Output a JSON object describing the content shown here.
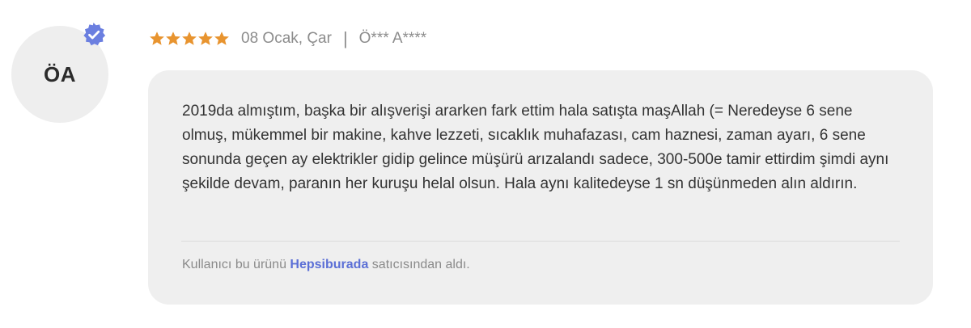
{
  "review": {
    "avatar_initials": "ÖA",
    "verified_icon": "verified-badge-icon",
    "rating": 5,
    "rating_max": 5,
    "star_color": "#e8942f",
    "date": "08 Ocak, Çar",
    "separator": "|",
    "author": "Ö*** A****",
    "text": "2019da almıştım, başka bir alışverişi ararken fark ettim hala satışta maşAllah (= Neredeyse 6 sene olmuş, mükemmel bir makine, kahve lezzeti, sıcaklık muhafazası, cam haznesi, zaman ayarı, 6 sene sonunda geçen ay elektrikler gidip gelince müşürü arızalandı sadece, 300-500e tamir ettirdim şimdi aynı şekilde devam, paranın her kuruşu helal olsun. Hala aynı kalitedeyse 1 sn düşünmeden alın aldırın.",
    "seller_prefix": "Kullanıcı bu ürünü ",
    "seller_name": "Hepsiburada",
    "seller_suffix": " satıcısından aldı.",
    "seller_color": "#5b6fd6",
    "badge_color": "#6b7fe0"
  }
}
